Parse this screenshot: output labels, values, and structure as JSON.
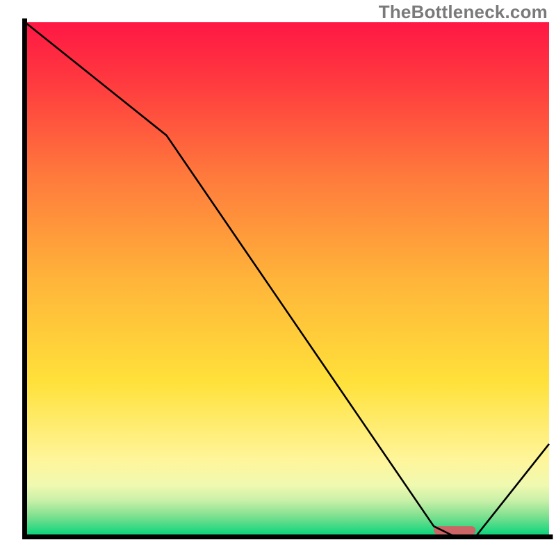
{
  "watermark": "TheBottleneck.com",
  "chart_data": {
    "type": "line",
    "title": "",
    "xlabel": "",
    "ylabel": "",
    "xlim": [
      0,
      100
    ],
    "ylim": [
      0,
      100
    ],
    "x": [
      0,
      27,
      78,
      82,
      86,
      100
    ],
    "values": [
      100,
      78,
      2,
      0,
      0,
      18
    ],
    "marker": {
      "x_start": 78,
      "x_end": 86,
      "y": 1.2,
      "color": "#cc6666"
    },
    "gradient_stops": [
      {
        "offset": 0.0,
        "color": "#ff1744"
      },
      {
        "offset": 0.12,
        "color": "#ff3b3f"
      },
      {
        "offset": 0.3,
        "color": "#ff7a3c"
      },
      {
        "offset": 0.5,
        "color": "#ffb43a"
      },
      {
        "offset": 0.7,
        "color": "#ffe13a"
      },
      {
        "offset": 0.85,
        "color": "#fff59a"
      },
      {
        "offset": 0.9,
        "color": "#f0f9b0"
      },
      {
        "offset": 0.93,
        "color": "#c9f0a8"
      },
      {
        "offset": 0.96,
        "color": "#80e090"
      },
      {
        "offset": 1.0,
        "color": "#00d47a"
      }
    ],
    "line_color": "#000000",
    "line_width": 2.6,
    "axis_color": "#000000",
    "axis_width": 7
  },
  "plot": {
    "margin_left": 36,
    "margin_right": 10,
    "margin_top": 32,
    "margin_bottom": 28,
    "inner_width": 754,
    "inner_height": 740
  }
}
